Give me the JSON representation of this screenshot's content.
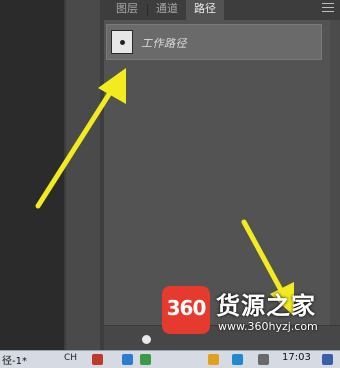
{
  "panel": {
    "tabs": [
      {
        "label": "图层"
      },
      {
        "label": "通道"
      },
      {
        "label": "路径"
      }
    ],
    "active_tab": "路径",
    "path_item": {
      "label": "工作路径"
    }
  },
  "taskbar": {
    "title_text": "径-1*",
    "ime_label": "CH",
    "clock": "17:03"
  },
  "watermark": {
    "badge": "360",
    "title": "货源之家",
    "url": "www.360hyzj.com"
  },
  "colors": {
    "arrow": "#f2ec1f",
    "panel_bg": "#535353",
    "accent_red": "#e63a2e"
  }
}
